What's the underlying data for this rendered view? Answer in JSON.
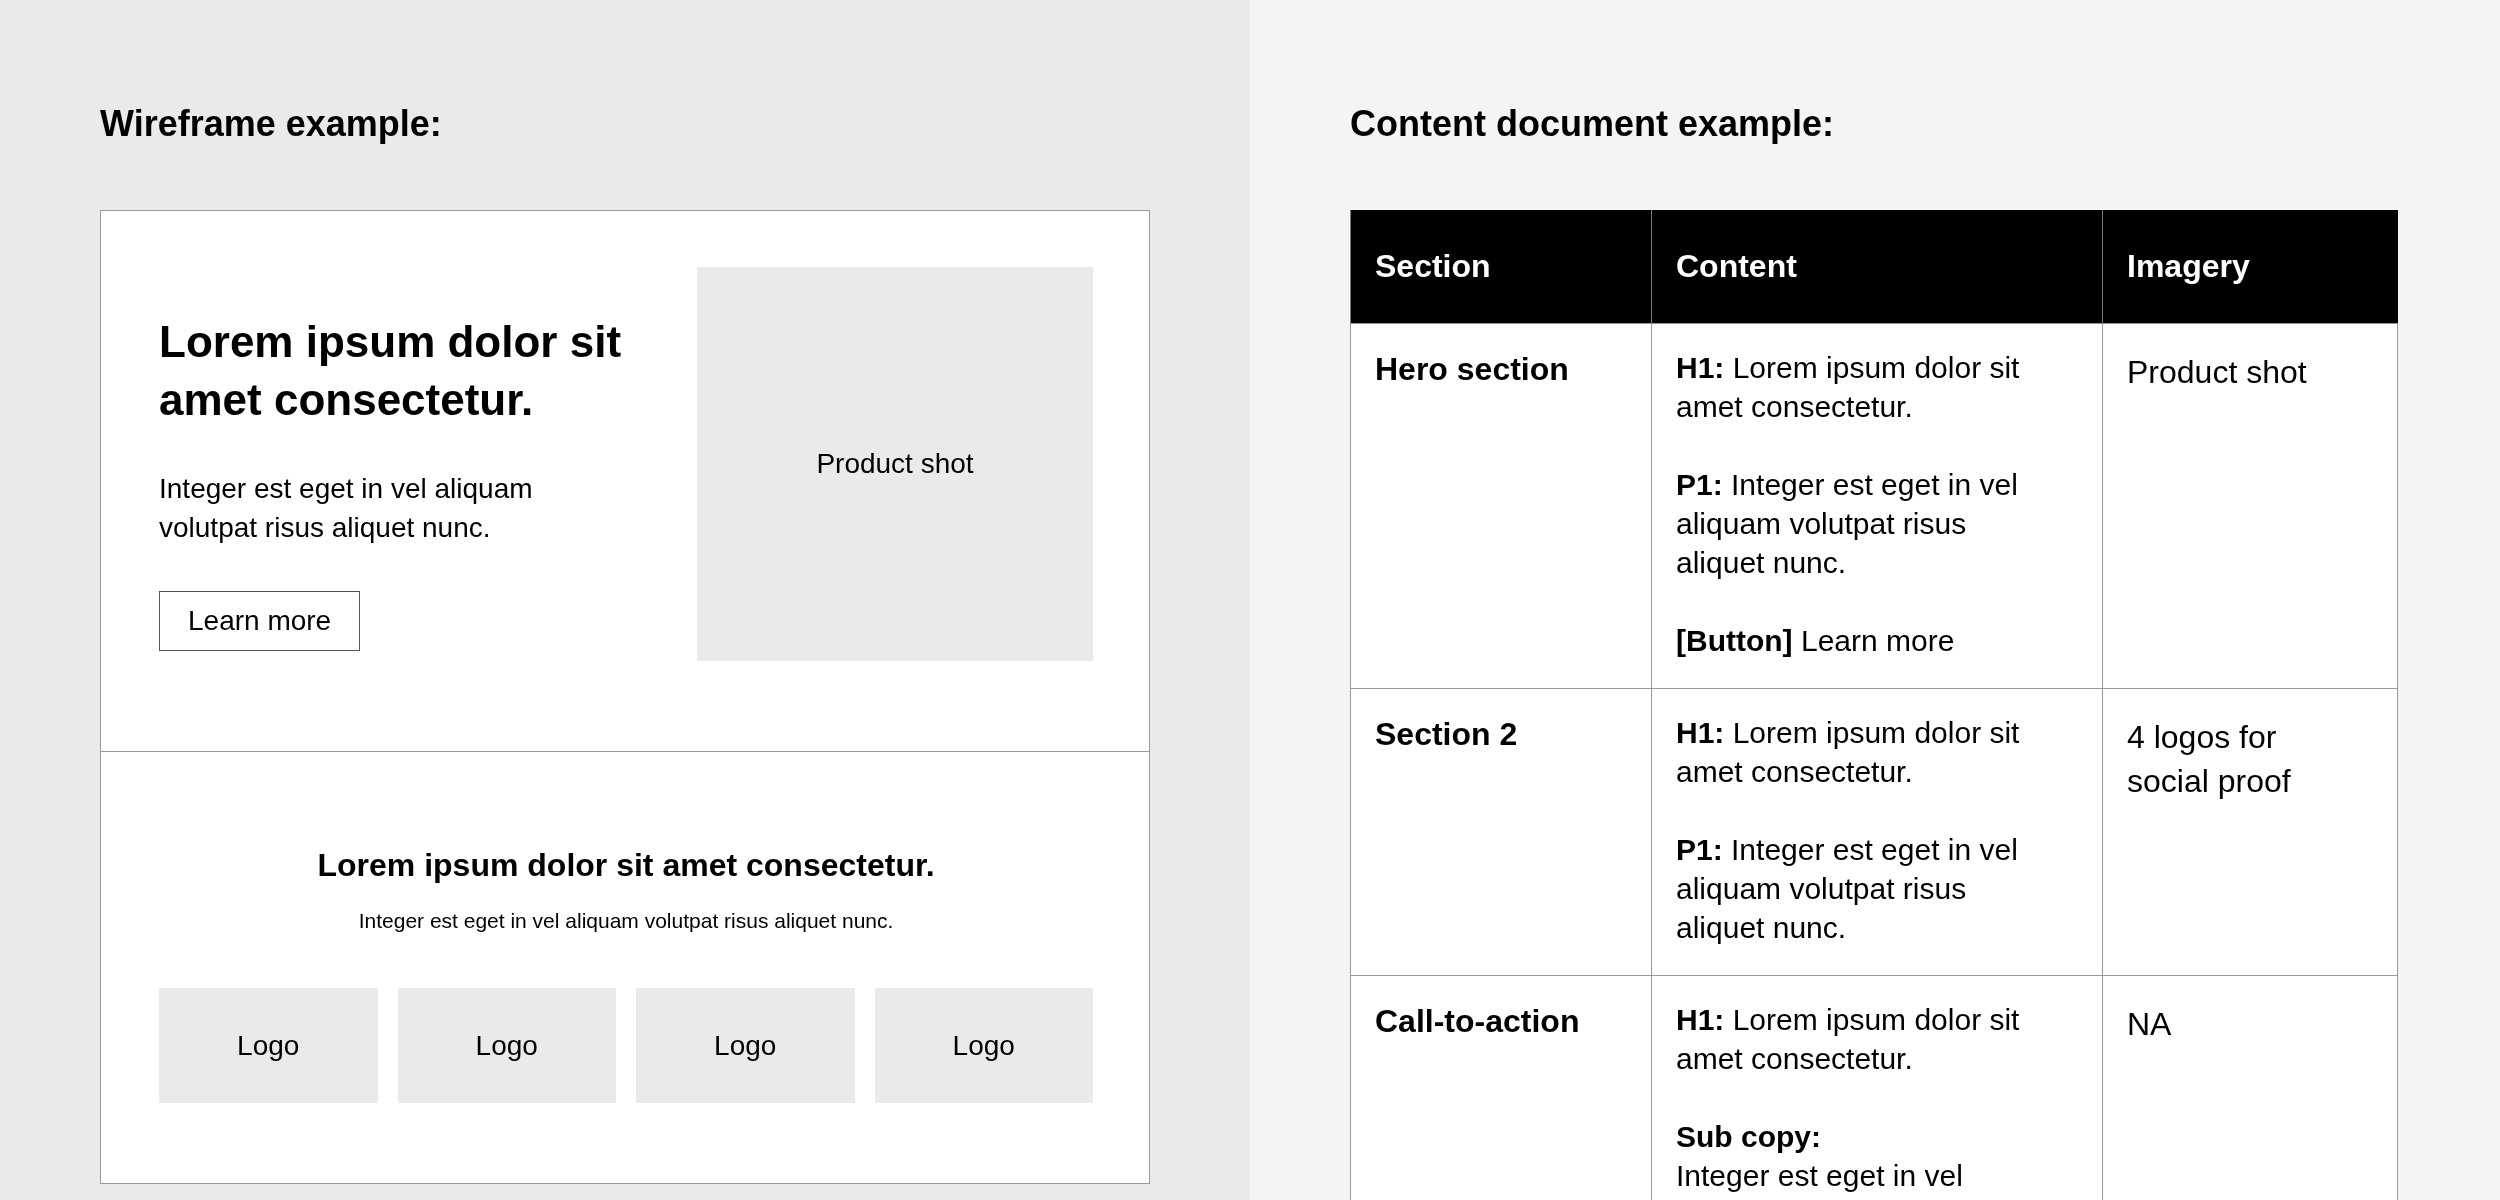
{
  "wireframe": {
    "title": "Wireframe example:",
    "hero": {
      "heading": "Lorem ipsum dolor sit amet consectetur.",
      "body": "Integer est eget in vel aliquam volutpat risus aliquet nunc.",
      "button": "Learn more",
      "image_label": "Product shot"
    },
    "section2": {
      "heading": "Lorem ipsum dolor sit amet consectetur.",
      "body": "Integer est eget in vel aliquam volutpat risus aliquet nunc.",
      "logos": [
        "Logo",
        "Logo",
        "Logo",
        "Logo"
      ]
    }
  },
  "content_doc": {
    "title": "Content document example:",
    "columns": [
      "Section",
      "Content",
      "Imagery"
    ],
    "rows": [
      {
        "section": "Hero section",
        "imagery": "Product shot",
        "content": [
          {
            "kind": "inline",
            "label": "H1:",
            "text": "Lorem ipsum dolor sit amet consectetur."
          },
          {
            "kind": "inline",
            "label": "P1:",
            "text": "Integer est eget in vel aliquam volutpat risus aliquet nunc."
          },
          {
            "kind": "inline",
            "label": "[Button]",
            "text": "Learn more"
          }
        ]
      },
      {
        "section": "Section 2",
        "imagery": "4 logos for social proof",
        "content": [
          {
            "kind": "inline",
            "label": "H1:",
            "text": "Lorem ipsum dolor sit amet consectetur."
          },
          {
            "kind": "inline",
            "label": "P1:",
            "text": "Integer est eget in vel aliquam volutpat risus aliquet nunc."
          }
        ]
      },
      {
        "section": "Call-to-action",
        "imagery": "NA",
        "content": [
          {
            "kind": "inline",
            "label": "H1:",
            "text": "Lorem ipsum dolor sit amet consectetur."
          },
          {
            "kind": "block",
            "label": "Sub copy:",
            "text": "Integer est eget in vel"
          }
        ]
      }
    ]
  }
}
